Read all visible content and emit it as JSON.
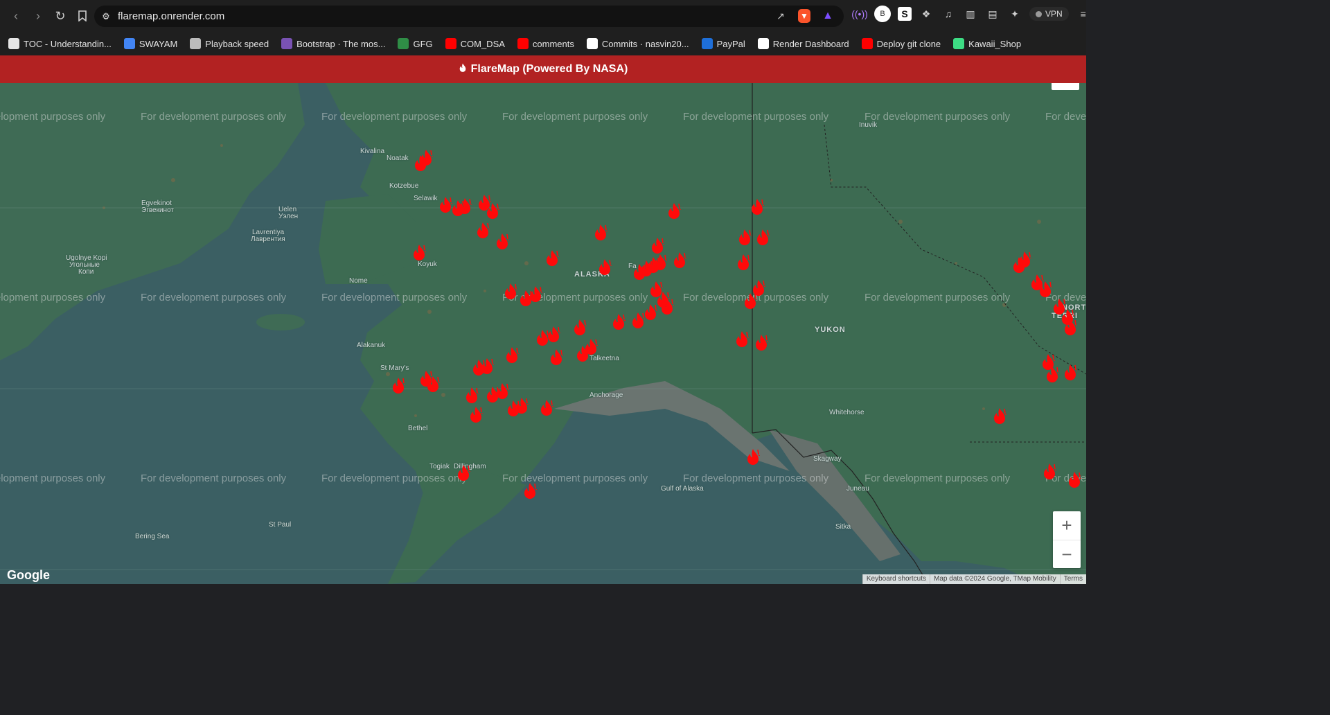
{
  "browser": {
    "url": "flaremap.onrender.com",
    "vpn_label": "VPN",
    "avatar_letter": "B"
  },
  "bookmarks": [
    {
      "label": "TOC - Understandin...",
      "icon": "heart-icon",
      "color": "#e6e6e6"
    },
    {
      "label": "SWAYAM",
      "icon": "swayam-icon",
      "color": "#4285f4"
    },
    {
      "label": "Playback speed",
      "icon": "globe-icon",
      "color": "#bbbbbb"
    },
    {
      "label": "Bootstrap · The mos...",
      "icon": "bootstrap-icon",
      "color": "#7952b3"
    },
    {
      "label": "GFG",
      "icon": "gfg-icon",
      "color": "#2f8d46"
    },
    {
      "label": "COM_DSA",
      "icon": "youtube-icon",
      "color": "#ff0000"
    },
    {
      "label": "comments",
      "icon": "youtube-icon",
      "color": "#ff0000"
    },
    {
      "label": "Commits · nasvin20...",
      "icon": "github-icon",
      "color": "#ffffff"
    },
    {
      "label": "PayPal",
      "icon": "paypal-icon",
      "color": "#1e6fd9"
    },
    {
      "label": "Render Dashboard",
      "icon": "render-icon",
      "color": "#ffffff"
    },
    {
      "label": "Deploy git clone",
      "icon": "youtube-icon",
      "color": "#ff0000"
    },
    {
      "label": "Kawaii_Shop",
      "icon": "shop-icon",
      "color": "#3ddc84"
    }
  ],
  "header": {
    "title": "FlareMap (Powered By NASA)",
    "icon": "fire-icon",
    "color": "#b22222"
  },
  "map": {
    "watermark": "For development purposes only",
    "places": [
      {
        "name": "Kivalina",
        "type": "place"
      },
      {
        "name": "Noatak",
        "type": "place"
      },
      {
        "name": "Kotzebue",
        "type": "place"
      },
      {
        "name": "Selawik",
        "type": "place"
      },
      {
        "name": "Egvekinot",
        "type": "place"
      },
      {
        "name": "Эгвекинот",
        "type": "place"
      },
      {
        "name": "Uelen",
        "type": "place"
      },
      {
        "name": "Уэлен",
        "type": "place"
      },
      {
        "name": "Lavrentiya",
        "type": "place"
      },
      {
        "name": "Лаврентия",
        "type": "place"
      },
      {
        "name": "Ugolnye Kopi",
        "type": "place"
      },
      {
        "name": "Угольные",
        "type": "place"
      },
      {
        "name": "Копи",
        "type": "place"
      },
      {
        "name": "Koyuk",
        "type": "place"
      },
      {
        "name": "Nome",
        "type": "place"
      },
      {
        "name": "ALASKA",
        "type": "region"
      },
      {
        "name": "Fa",
        "type": "place"
      },
      {
        "name": "Inuvik",
        "type": "place"
      },
      {
        "name": "YUKON",
        "type": "region"
      },
      {
        "name": "NORT",
        "type": "region"
      },
      {
        "name": "TERRI",
        "type": "region"
      },
      {
        "name": "Alakanuk",
        "type": "place"
      },
      {
        "name": "St Mary's",
        "type": "place"
      },
      {
        "name": "Talkeetna",
        "type": "place"
      },
      {
        "name": "Anchorage",
        "type": "place"
      },
      {
        "name": "Bethel",
        "type": "place"
      },
      {
        "name": "Whitehorse",
        "type": "place"
      },
      {
        "name": "Skagway",
        "type": "place"
      },
      {
        "name": "Togiak",
        "type": "place"
      },
      {
        "name": "Dillingham",
        "type": "place"
      },
      {
        "name": "Gulf of Alaska",
        "type": "water"
      },
      {
        "name": "Juneau",
        "type": "place"
      },
      {
        "name": "Sitka",
        "type": "place"
      },
      {
        "name": "St Paul",
        "type": "place"
      },
      {
        "name": "Bering Sea",
        "type": "water"
      }
    ],
    "fire_count": 72,
    "zoom_in": "+",
    "zoom_out": "−",
    "google_logo": "Google",
    "attribution": [
      "Keyboard shortcuts",
      "Map data ©2024 Google, TMap Mobility",
      "Terms"
    ]
  }
}
